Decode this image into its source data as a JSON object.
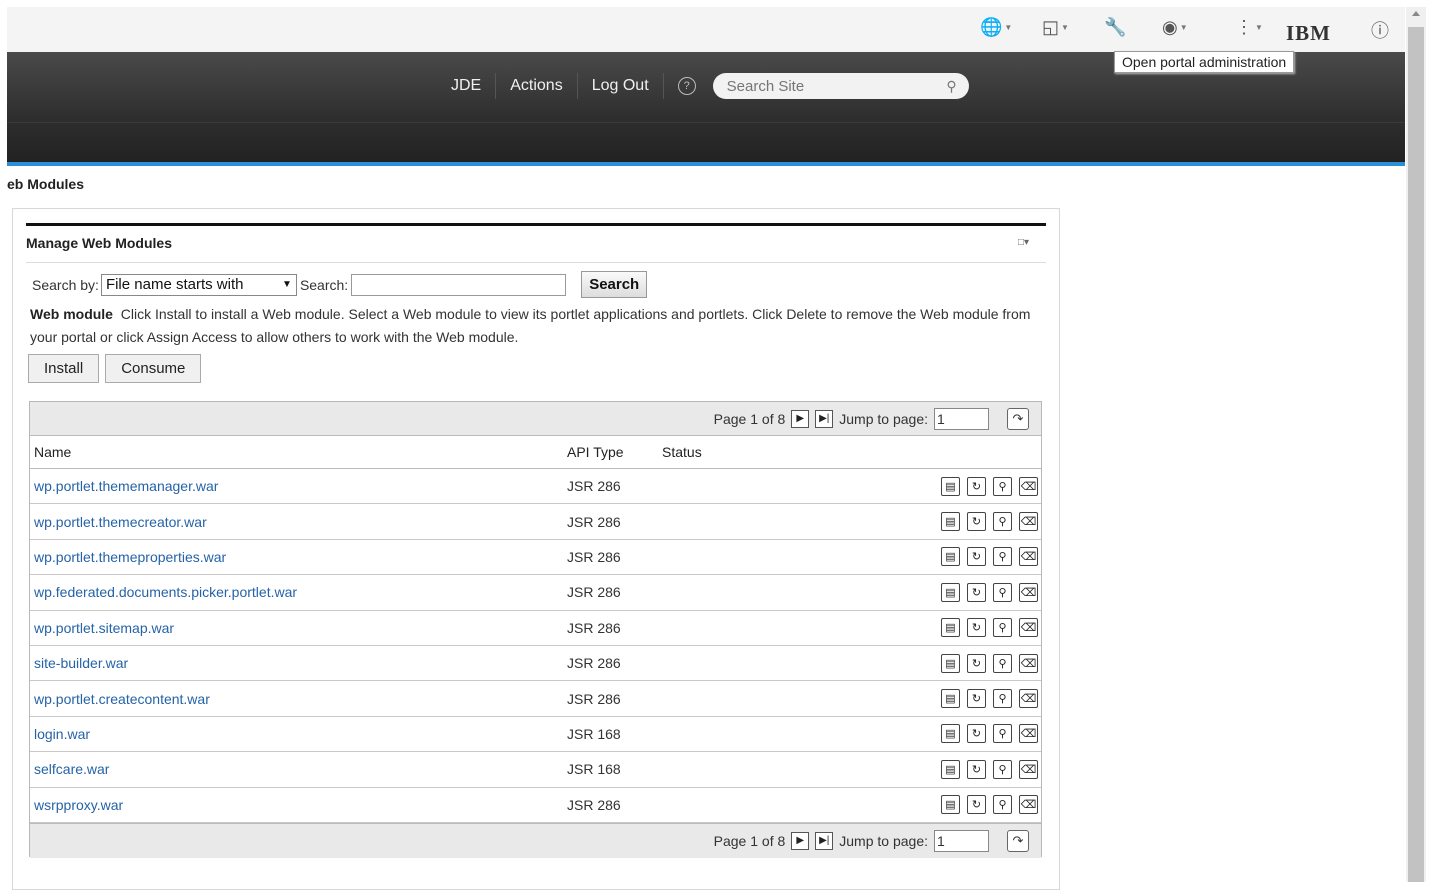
{
  "toolbar": {
    "icons": [
      "globe-icon",
      "page-icon",
      "wrench-icon",
      "eye-icon",
      "more-icon",
      "info-icon"
    ],
    "brand": "IBM",
    "tooltip": "Open portal administration"
  },
  "header": {
    "nav": [
      "JDE",
      "Actions",
      "Log Out"
    ],
    "search_placeholder": "Search Site"
  },
  "breadcrumb": "eb Modules",
  "portlet": {
    "title": "Manage Web Modules",
    "search_by_label": "Search by:",
    "search_by_value": "File name starts with",
    "search_label": "Search:",
    "search_button": "Search",
    "desc_bold": "Web module",
    "desc_text": "Click Install to install a Web module. Select a Web module to view its portlet applications and portlets. Click Delete to remove the Web module from your portal or click Assign Access to allow others to work with the Web module.",
    "install_label": "Install",
    "consume_label": "Consume"
  },
  "pager": {
    "page_text": "Page 1 of 8",
    "jump_label": "Jump to page:",
    "jump_value": "1"
  },
  "table": {
    "columns": [
      "Name",
      "API Type",
      "Status"
    ],
    "rows": [
      {
        "name": "wp.portlet.thememanager.war",
        "api": "JSR 286",
        "status": ""
      },
      {
        "name": "wp.portlet.themecreator.war",
        "api": "JSR 286",
        "status": ""
      },
      {
        "name": "wp.portlet.themeproperties.war",
        "api": "JSR 286",
        "status": ""
      },
      {
        "name": "wp.federated.documents.picker.portlet.war",
        "api": "JSR 286",
        "status": ""
      },
      {
        "name": "wp.portlet.sitemap.war",
        "api": "JSR 286",
        "status": ""
      },
      {
        "name": "site-builder.war",
        "api": "JSR 286",
        "status": ""
      },
      {
        "name": "wp.portlet.createcontent.war",
        "api": "JSR 286",
        "status": ""
      },
      {
        "name": "login.war",
        "api": "JSR 168",
        "status": ""
      },
      {
        "name": "selfcare.war",
        "api": "JSR 168",
        "status": ""
      },
      {
        "name": "wsrpproxy.war",
        "api": "JSR 286",
        "status": ""
      }
    ],
    "row_action_icons": [
      "details-icon",
      "update-icon",
      "assign-access-icon",
      "delete-icon"
    ]
  }
}
